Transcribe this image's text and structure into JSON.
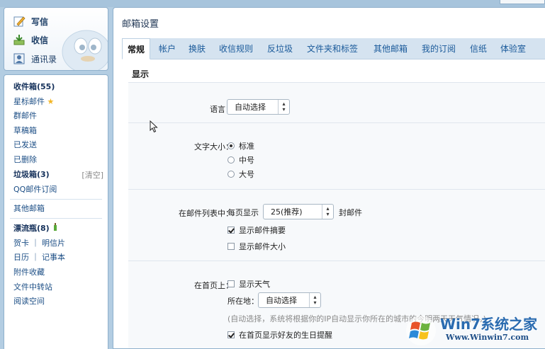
{
  "left": {
    "quick_links": [
      {
        "label": "写信",
        "icon": "write-mail-icon"
      },
      {
        "label": "收信",
        "icon": "inbox-download-icon"
      },
      {
        "label": "通讯录",
        "icon": "contacts-icon"
      }
    ],
    "nav": [
      {
        "label": "收件箱(55)"
      },
      {
        "label": "星标邮件"
      },
      {
        "label": "群邮件"
      },
      {
        "label": "草稿箱"
      },
      {
        "label": "已发送"
      },
      {
        "label": "已删除"
      },
      {
        "label": "垃圾箱(3)",
        "action": "[清空]"
      },
      {
        "label": "QQ邮件订阅"
      },
      {
        "label": "其他邮箱"
      },
      {
        "label": "漂流瓶(8)"
      },
      {
        "label": "贺卡 ｜ 明信片"
      },
      {
        "label": "日历 ｜ 记事本"
      },
      {
        "label": "附件收藏"
      },
      {
        "label": "文件中转站"
      },
      {
        "label": "阅读空间"
      }
    ]
  },
  "main": {
    "title": "邮箱设置",
    "tabs": [
      "常规",
      "帐户",
      "换肤",
      "收信规则",
      "反垃圾",
      "文件夹和标签",
      "其他邮箱",
      "我的订阅",
      "信纸",
      "体验室"
    ],
    "active_tab": "常规",
    "section_title": "显示",
    "settings": {
      "language": {
        "label": "语言：",
        "value": "自动选择"
      },
      "font_size": {
        "label": "文字大小：",
        "options": [
          {
            "label": "标准",
            "selected": true
          },
          {
            "label": "中号",
            "selected": false
          },
          {
            "label": "大号",
            "selected": false
          }
        ]
      },
      "mail_list": {
        "label": "在邮件列表中：",
        "per_page_prefix": "每页显示",
        "per_page_value": "25(推荐)",
        "per_page_suffix": "封邮件",
        "show_summary": {
          "label": "显示邮件摘要",
          "checked": true
        },
        "show_size": {
          "label": "显示邮件大小",
          "checked": false
        }
      },
      "home": {
        "label": "在首页上：",
        "show_weather": {
          "label": "显示天气",
          "checked": false
        },
        "location_label": "所在地：",
        "location_value": "自动选择",
        "location_hint": "(自动选择，系统将根据你的IP自动显示你所在的城市的今明两天天气情况。)",
        "birthday": {
          "label": "在首页显示好友的生日提醒",
          "checked": true
        }
      }
    }
  },
  "watermark": {
    "brand": "Win7系统之家",
    "url": "Www.Winwin7.com"
  },
  "colors": {
    "accent": "#1d4f86",
    "tab_bar": "#d5e3f0",
    "background": "#b3cde2"
  }
}
